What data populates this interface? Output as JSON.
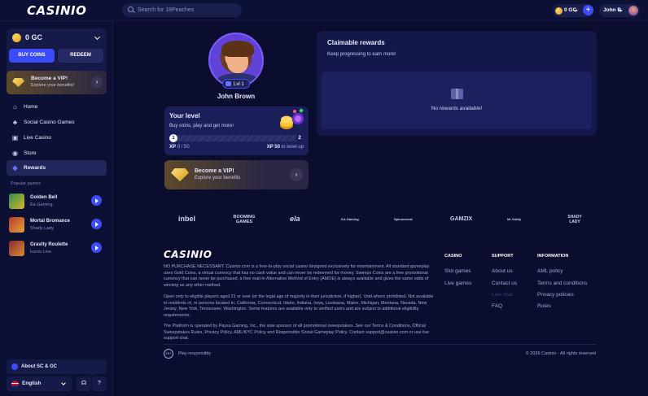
{
  "brand": {
    "logo": "CASINIO"
  },
  "search": {
    "placeholder": "Search for 18Peaches"
  },
  "header": {
    "balance": "0 GC",
    "user_name": "John B"
  },
  "sidebar": {
    "balance": "0 GC",
    "buy_label": "BUY COINS",
    "redeem_label": "REDEEM",
    "vip": {
      "title": "Become a VIP!",
      "subtitle": "Explore your benefits!"
    },
    "nav": [
      {
        "label": "Home",
        "icon": "home-icon"
      },
      {
        "label": "Social Casino Games",
        "icon": "cherries-icon"
      },
      {
        "label": "Live Casino",
        "icon": "live-icon"
      },
      {
        "label": "Store",
        "icon": "store-icon"
      },
      {
        "label": "Rewards",
        "icon": "diamond-icon"
      }
    ],
    "popular_label": "Popular games",
    "games": [
      {
        "name": "Golden Bell",
        "provider": "Ka Gaming"
      },
      {
        "name": "Mortal Bromance",
        "provider": "Shady Lady"
      },
      {
        "name": "Gravity Roulette",
        "provider": "Iconic Live"
      }
    ],
    "about_label": "About SC & GC",
    "language": "English"
  },
  "profile": {
    "level_badge": "Lvl 1",
    "name": "John Brown",
    "level_card": {
      "title": "Your level",
      "subtitle": "Buy coins, play and get more!",
      "current_level": "1",
      "next_level": "2",
      "progress": 0,
      "xp_label": "XP",
      "xp_value": "0 / 50",
      "xp_to_next": "XP 50",
      "to_level_up": "to level up"
    },
    "vip": {
      "title": "Become a VIP!",
      "subtitle": "Explore your benefits"
    }
  },
  "rewards": {
    "title": "Claimable rewards",
    "subtitle": "Keep progressing to earn more!",
    "empty_text": "No rewards available!"
  },
  "providers": [
    "inbel",
    "BOOMING GAMES",
    "ela",
    "KA Gaming",
    "Spinomenal",
    "GAMZIX",
    "Mr Slotty",
    "SHADY LADY"
  ],
  "footer": {
    "logo": "CASINIO",
    "legal": [
      "NO PURCHASE NECESSARY. Casinio.com is a free-to-play social casino designed exclusively for entertainment. All standard gameplay uses Gold Coins, a virtual currency that has no cash value and can never be redeemed for money. Sweeps Coins are a free promotional currency that can never be purchased, a free mail-in Alternative Method of Entry (AMOE) is always available and gives the same odds of winning as any other method.",
      "Open only to eligible players aged 21 or over (or the legal age of majority in their jurisdiction, if higher). Void where prohibited. Not available to residents of, or persons located in, California, Connecticut, Idaho, Indiana, Iowa, Louisiana, Maine, Michigan, Montana, Nevada, New Jersey, New York, Tennessee, Washington. Some features are available only to verified users and are subject to additional eligibility requirements.",
      "The Platform is operated by Paysa Gaming, Inc., the sole sponsor of all promotional sweepstakes. See our Terms & Conditions, Official Sweepstakes Rules, Privacy Policy, AML/KYC Policy and Responsible Social Gameplay Policy. Contact support@casinio.com or use live support chat."
    ],
    "columns": [
      {
        "heading": "CASINO",
        "links": [
          "Slot games",
          "Live games"
        ]
      },
      {
        "heading": "SUPPORT",
        "links": [
          "About us",
          "Contact us",
          "Live chat",
          "FAQ"
        ]
      },
      {
        "heading": "INFORMATION",
        "links": [
          "AML policy",
          "Terms and conditions",
          "Privacy policies",
          "Rules"
        ]
      }
    ],
    "age_badge": "18+",
    "responsible": "Play responsibly",
    "copyright": "© 2026 Casinio - All rights reserved"
  }
}
